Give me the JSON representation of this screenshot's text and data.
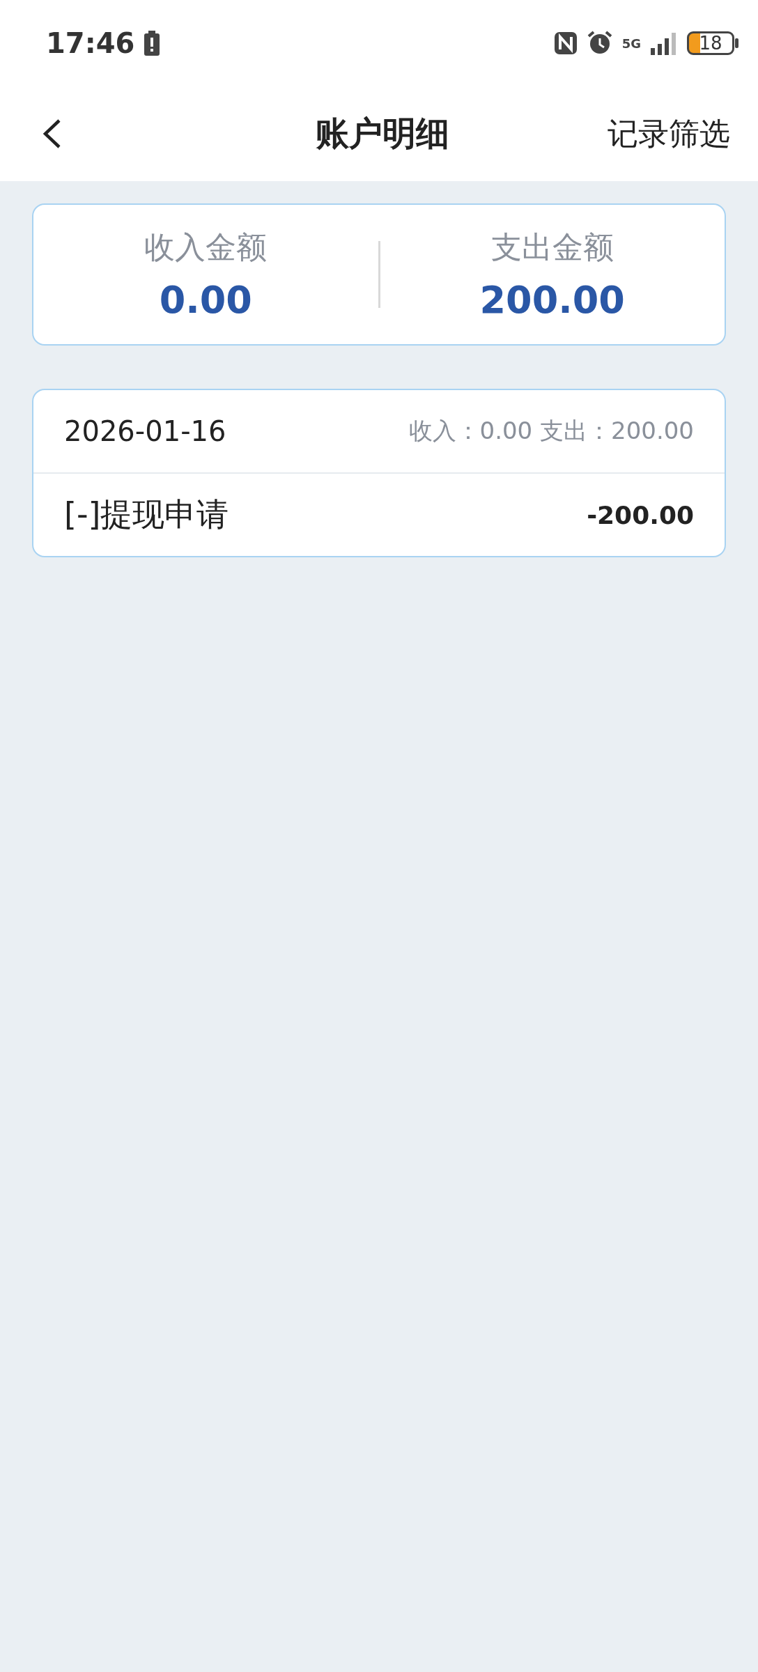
{
  "status_bar": {
    "time": "17:46",
    "network": "5G",
    "battery": "18"
  },
  "header": {
    "title": "账户明细",
    "action": "记录筛选"
  },
  "summary": [
    {
      "label": "收入金额",
      "value": "0.00"
    },
    {
      "label": "支出金额",
      "value": "200.00"
    }
  ],
  "days": [
    {
      "date": "2026-01-16",
      "totals": "收入：0.00 支出：200.00",
      "records": [
        {
          "title": "[-]提现申请",
          "amount": "-200.00"
        }
      ]
    }
  ]
}
